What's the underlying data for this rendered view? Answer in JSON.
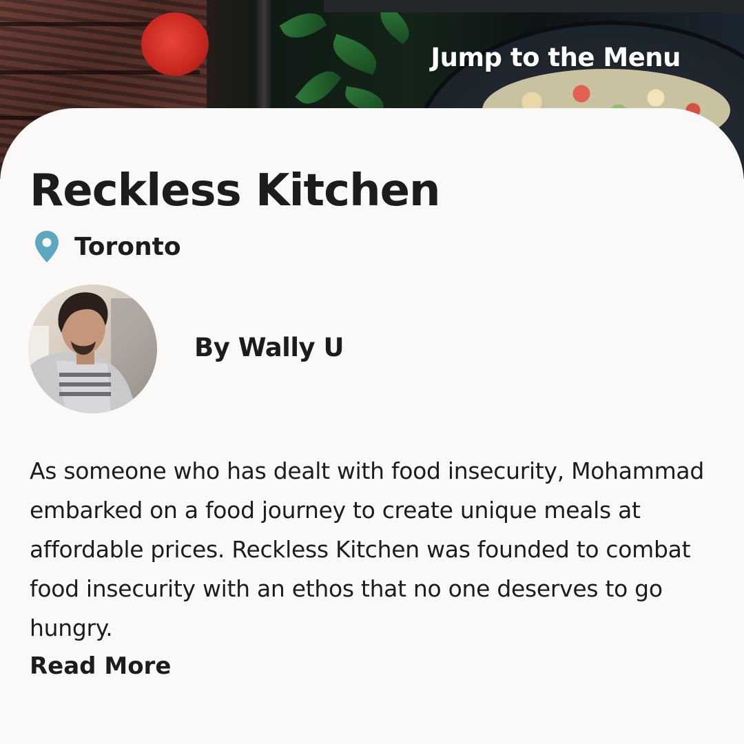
{
  "hero": {
    "jump_link": "Jump to the Menu"
  },
  "restaurant": {
    "name": "Reckless Kitchen",
    "location": "Toronto",
    "author": "By Wally U",
    "description": "As someone who has dealt with food insecurity, Mohammad embarked on a food journey to create unique meals at affordable prices.  Reckless Kitchen was founded to combat food insecurity with an ethos that no one deserves to go hungry.",
    "read_more": "Read More"
  },
  "colors": {
    "pin": "#5aa9bf",
    "text": "#1c1c1c",
    "card_background": "#faf9f7"
  },
  "icons": {
    "location": "map-pin-icon",
    "avatar": "chef-avatar"
  }
}
